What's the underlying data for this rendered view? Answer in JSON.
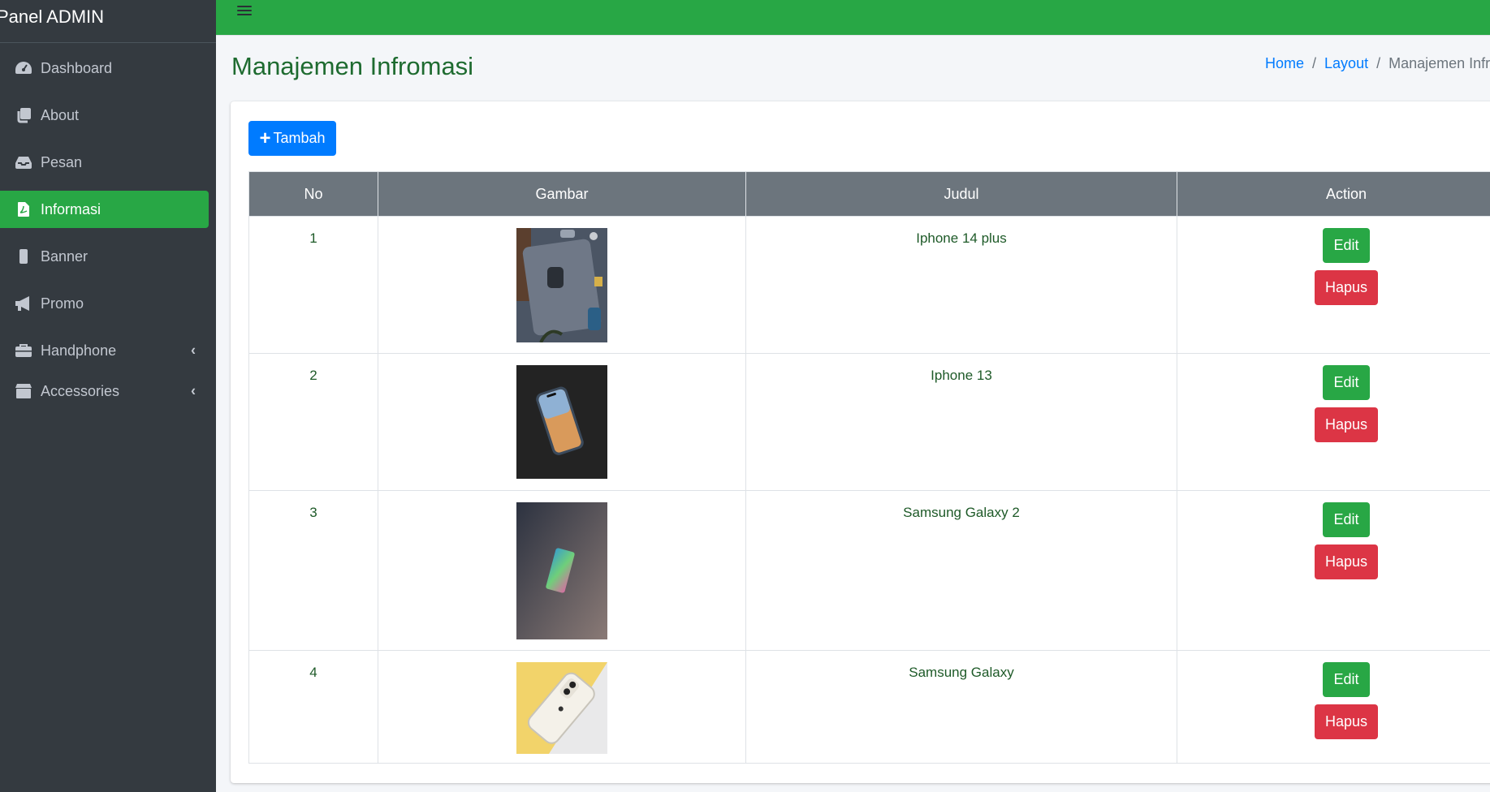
{
  "brand": "Panel ADMIN",
  "sidebar": {
    "items": [
      {
        "label": "Dashboard",
        "icon": "dashboard-icon"
      },
      {
        "label": "About",
        "icon": "copy-icon"
      },
      {
        "label": "Pesan",
        "icon": "inbox-icon"
      },
      {
        "label": "Informasi",
        "icon": "file-icon",
        "active": true
      },
      {
        "label": "Banner",
        "icon": "mobile-icon"
      },
      {
        "label": "Promo",
        "icon": "bullhorn-icon"
      },
      {
        "label": "Handphone",
        "icon": "briefcase-icon",
        "caret": "‹"
      },
      {
        "label": "Accessories",
        "icon": "box-icon",
        "caret": "‹"
      }
    ]
  },
  "header": {
    "title": "Manajemen Infromasi",
    "breadcrumb": [
      "Home",
      "Layout",
      "Manajemen Infromasi"
    ]
  },
  "toolbar": {
    "add_label": "Tambah"
  },
  "table": {
    "columns": [
      "No",
      "Gambar",
      "Judul",
      "Action"
    ],
    "rows": [
      {
        "no": "1",
        "title": "Iphone 14 plus",
        "image": "iphone-14-plus-photo",
        "edit": "Edit",
        "delete": "Hapus"
      },
      {
        "no": "2",
        "title": "Iphone 13",
        "image": "iphone-13-photo",
        "edit": "Edit",
        "delete": "Hapus"
      },
      {
        "no": "3",
        "title": "Samsung Galaxy 2",
        "image": "samsung-galaxy-2-photo",
        "edit": "Edit",
        "delete": "Hapus"
      },
      {
        "no": "4",
        "title": "Samsung Galaxy",
        "image": "samsung-galaxy-photo",
        "edit": "Edit",
        "delete": "Hapus"
      }
    ]
  },
  "colors": {
    "topbar": "#28a745",
    "sidebar": "#343a40",
    "active": "#28a745",
    "primary": "#007bff",
    "danger": "#dc3545",
    "table_header": "#6c757d"
  }
}
